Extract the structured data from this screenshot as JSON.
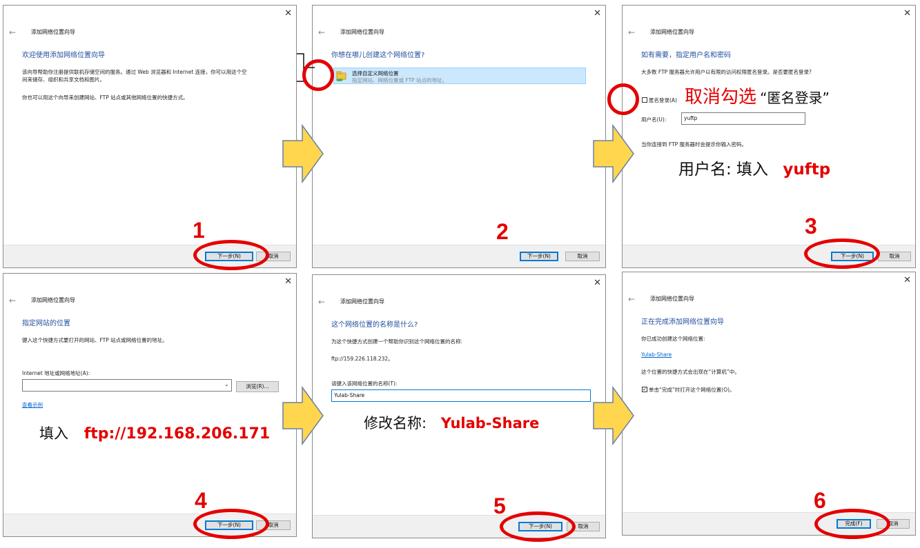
{
  "wizard": {
    "title": "添加网络位置向导",
    "next_label": "下一步(N)",
    "cancel_label": "取消",
    "finish_label": "完成(F)",
    "close_glyph": "✕",
    "back_glyph": "←"
  },
  "step1": {
    "heading": "欢迎使用添加网络位置向导",
    "line1": "该向导帮助你注册提供联机存储空间的服务。通过 Web 浏览器和 Internet 连接，你可以用这个空",
    "line2": "间来储存、组织和共享文档和图片。",
    "line3": "你也可以用这个向导来创建网站、FTP 站点或其他网络位置的快捷方式。"
  },
  "step2": {
    "heading": "你想在哪儿创建这个网络位置?",
    "option_title": "选择自定义网络位置",
    "option_desc": "指定网站、网络位置或 FTP 站点的地址。"
  },
  "step3": {
    "heading": "如有需要，指定用户名和密码",
    "desc": "大多数 FTP 服务器允许用户以有限的访问权限匿名登录。是否要匿名登录?",
    "anon_label": "匿名登录(A)",
    "user_label": "用户名(U):",
    "user_value": "yuftp",
    "pwd_note": "当你连接到 FTP 服务器时会提示你输入密码。"
  },
  "step4": {
    "heading": "指定网站的位置",
    "desc": "键入这个快捷方式要打开的网站、FTP 站点或网络位置的地址。",
    "addr_label": "Internet 地址或网络地址(A):",
    "addr_value": "",
    "browse_label": "浏览(R)...",
    "example_link": "查看示例"
  },
  "step5": {
    "heading": "这个网络位置的名称是什么?",
    "desc": "为这个快捷方式创建一个帮助你识别这个网络位置的名称:",
    "address": "ftp://159.226.118.232。",
    "name_label": "请键入该网络位置的名称(T):",
    "name_value": "Yulab-Share"
  },
  "step6": {
    "heading": "正在完成添加网络位置向导",
    "desc": "你已成功创建这个网络位置:",
    "link": "Yulab-Share",
    "desc2": "这个位置的快捷方式会出现在“计算机”中。",
    "open_label": "单击“完成”时打开这个网络位置(O)。"
  },
  "annotations": {
    "n1": "1",
    "n2": "2",
    "n3": "3",
    "n4": "4",
    "n5": "5",
    "n6": "6",
    "uncheck_red": "取消勾选",
    "uncheck_black": "“匿名登录”",
    "user_prefix": "用户名:  填入",
    "user_value": "yuftp",
    "addr_prefix": "填入",
    "addr_value": "ftp://192.168.206.171",
    "name_prefix": "修改名称:",
    "name_value": "Yulab-Share"
  },
  "colors": {
    "annotation_red": "#e40000",
    "heading_blue": "#1f4e9c",
    "arrow_yellow": "#ffd64d"
  }
}
